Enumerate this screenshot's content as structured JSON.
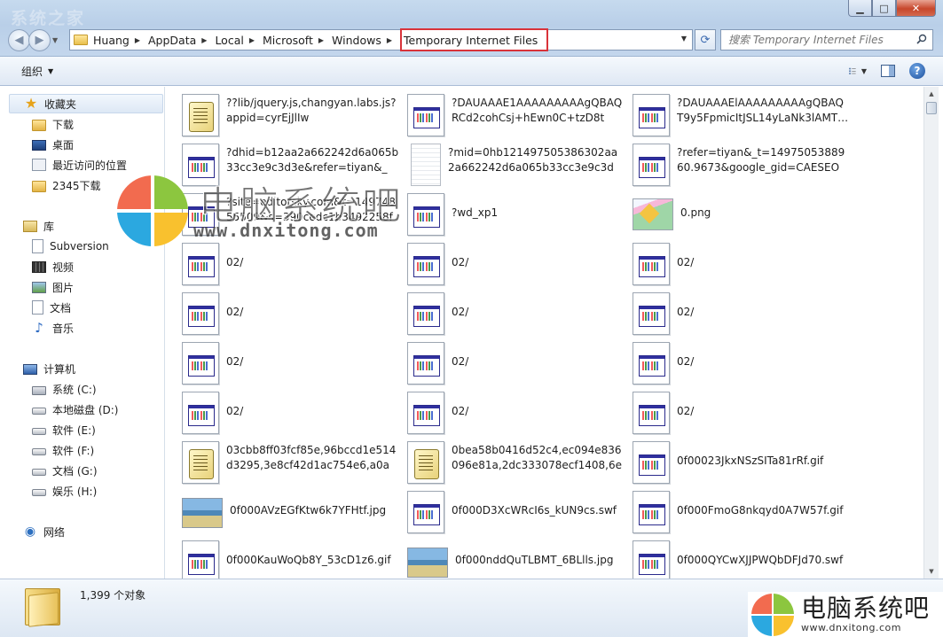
{
  "window": {
    "faded_title": "系统之家",
    "controls": {
      "minimize": "▁",
      "maximize": "□",
      "close": "✕"
    }
  },
  "address": {
    "breadcrumbs": [
      "Huang",
      "AppData",
      "Local",
      "Microsoft",
      "Windows",
      "Temporary Internet Files"
    ],
    "search_placeholder": "搜索 Temporary Internet Files"
  },
  "toolbar": {
    "organize_label": "组织"
  },
  "nav": {
    "favorites": {
      "label": "收藏夹",
      "items": [
        "下载",
        "桌面",
        "最近访问的位置",
        "2345下载"
      ]
    },
    "libraries": {
      "label": "库",
      "items": [
        "Subversion",
        "视频",
        "图片",
        "文档",
        "音乐"
      ]
    },
    "computer": {
      "label": "计算机",
      "items": [
        "系统 (C:)",
        "本地磁盘 (D:)",
        "软件 (E:)",
        "软件 (F:)",
        "文档 (G:)",
        "娱乐 (H:)"
      ]
    },
    "network": {
      "label": "网络"
    }
  },
  "files": [
    {
      "name": "??lib/jquery.js,changyan.labs.js?appid=cyrEjJlIw",
      "icon": "script-icon"
    },
    {
      "name": "?DAUAAAE1AAAAAAAAAgQBAQRCd2cohCsj+hEwn0C+tzD8tm…",
      "icon": "web-page-icon"
    },
    {
      "name": "?DAUAAAElAAAAAAAAAgQBAQT9y5FpmicItJSL14yLaNk3lAMT…",
      "icon": "web-page-icon"
    },
    {
      "name": "?dhid=b12aa2a662242d6a065b33cc3e9c3d3e&refer=tiyan&_t…",
      "icon": "web-page-icon"
    },
    {
      "name": "?mid=0hb121497505386302aa2a662242d6a065b33cc3e9c3d3…",
      "icon": "blank-file-icon"
    },
    {
      "name": "?refer=tiyan&_t=1497505388960.9673&google_gid=CAESEO_…",
      "icon": "web-page-icon"
    },
    {
      "name": "?site=editorsky.com&t=14974855509&s=390cedc1b3492258f8…",
      "icon": "web-page-icon"
    },
    {
      "name": "?wd_xp1",
      "icon": "web-page-icon"
    },
    {
      "name": "0.png",
      "icon": "png-image-icon"
    },
    {
      "name": "02/",
      "icon": "web-page-icon"
    },
    {
      "name": "02/",
      "icon": "web-page-icon"
    },
    {
      "name": "02/",
      "icon": "web-page-icon"
    },
    {
      "name": "02/",
      "icon": "web-page-icon"
    },
    {
      "name": "02/",
      "icon": "web-page-icon"
    },
    {
      "name": "02/",
      "icon": "web-page-icon"
    },
    {
      "name": "02/",
      "icon": "web-page-icon"
    },
    {
      "name": "02/",
      "icon": "web-page-icon"
    },
    {
      "name": "02/",
      "icon": "web-page-icon"
    },
    {
      "name": "02/",
      "icon": "web-page-icon"
    },
    {
      "name": "02/",
      "icon": "web-page-icon"
    },
    {
      "name": "02/",
      "icon": "web-page-icon"
    },
    {
      "name": "03cbb8ff03fcf85e,96bccd1e514d3295,3e8cf42d1ac754e6,a0ae…",
      "icon": "script-icon"
    },
    {
      "name": "0bea58b0416d52c4,ec094e836096e81a,2dc333078ecf1408,6ed…",
      "icon": "script-icon"
    },
    {
      "name": "0f00023JkxNSzSITa81rRf.gif",
      "icon": "web-page-icon"
    },
    {
      "name": "0f000AVzEGfKtw6k7YFHtf.jpg",
      "icon": "photo-icon"
    },
    {
      "name": "0f000D3XcWRcI6s_kUN9cs.swf",
      "icon": "web-page-icon"
    },
    {
      "name": "0f000FmoG8nkqyd0A7W57f.gif",
      "icon": "web-page-icon"
    },
    {
      "name": "0f000KauWoQb8Y_53cD1z6.gif",
      "icon": "web-page-icon"
    },
    {
      "name": "0f000nddQuTLBMT_6BLlls.jpg",
      "icon": "photo-icon"
    },
    {
      "name": "0f000QYCwXJJPWQbDFJd70.swf",
      "icon": "web-page-icon"
    }
  ],
  "status": {
    "count_text": "1,399 个对象"
  },
  "watermark": {
    "title": "电脑系统吧",
    "url": "www.dnxitong.com",
    "colors": [
      "#f26b4f",
      "#8cc63f",
      "#2ba8e0",
      "#f9c12e"
    ]
  }
}
